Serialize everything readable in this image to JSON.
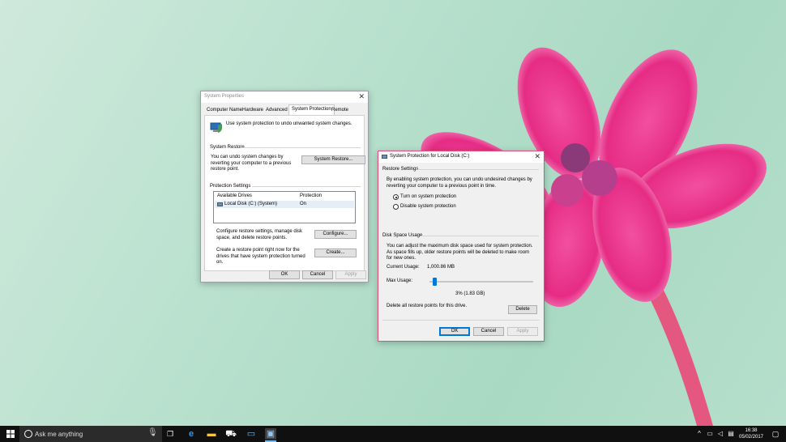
{
  "sysprops": {
    "title": "System Properties",
    "tabs": [
      "Computer Name",
      "Hardware",
      "Advanced",
      "System Protection",
      "Remote"
    ],
    "intro": "Use system protection to undo unwanted system changes.",
    "restore_heading": "System Restore",
    "restore_text": "You can undo system changes by reverting your computer to a previous restore point.",
    "restore_button": "System Restore...",
    "protection_heading": "Protection Settings",
    "col_drives": "Available Drives",
    "col_protection": "Protection",
    "drive_name": "Local Disk (C:) (System)",
    "drive_status": "On",
    "configure_text": "Configure restore settings, manage disk space, and delete restore points.",
    "configure_button": "Configure...",
    "create_text": "Create a restore point right now for the drives that have system protection turned on.",
    "create_button": "Create...",
    "ok": "OK",
    "cancel": "Cancel",
    "apply": "Apply"
  },
  "protdlg": {
    "title": "System Protection for Local Disk (C:)",
    "restore_heading": "Restore Settings",
    "restore_text": "By enabling system protection, you can undo undesired changes by reverting your computer to a previous point in time.",
    "radio_on": "Turn on system protection",
    "radio_off": "Disable system protection",
    "usage_heading": "Disk Space Usage",
    "usage_text": "You can adjust the maximum disk space used for system protection. As space fills up, older restore points will be deleted to make room for new ones.",
    "current_label": "Current Usage:",
    "current_value": "1,000.86 MB",
    "max_label": "Max Usage:",
    "max_fraction": 0.03,
    "max_value": "3% (1.83 GB)",
    "delete_text": "Delete all restore points for this drive.",
    "delete_button": "Delete",
    "ok": "OK",
    "cancel": "Cancel",
    "apply": "Apply"
  },
  "taskbar": {
    "search_placeholder": "Ask me anything",
    "time": "16:38",
    "date": "05/02/2017"
  }
}
